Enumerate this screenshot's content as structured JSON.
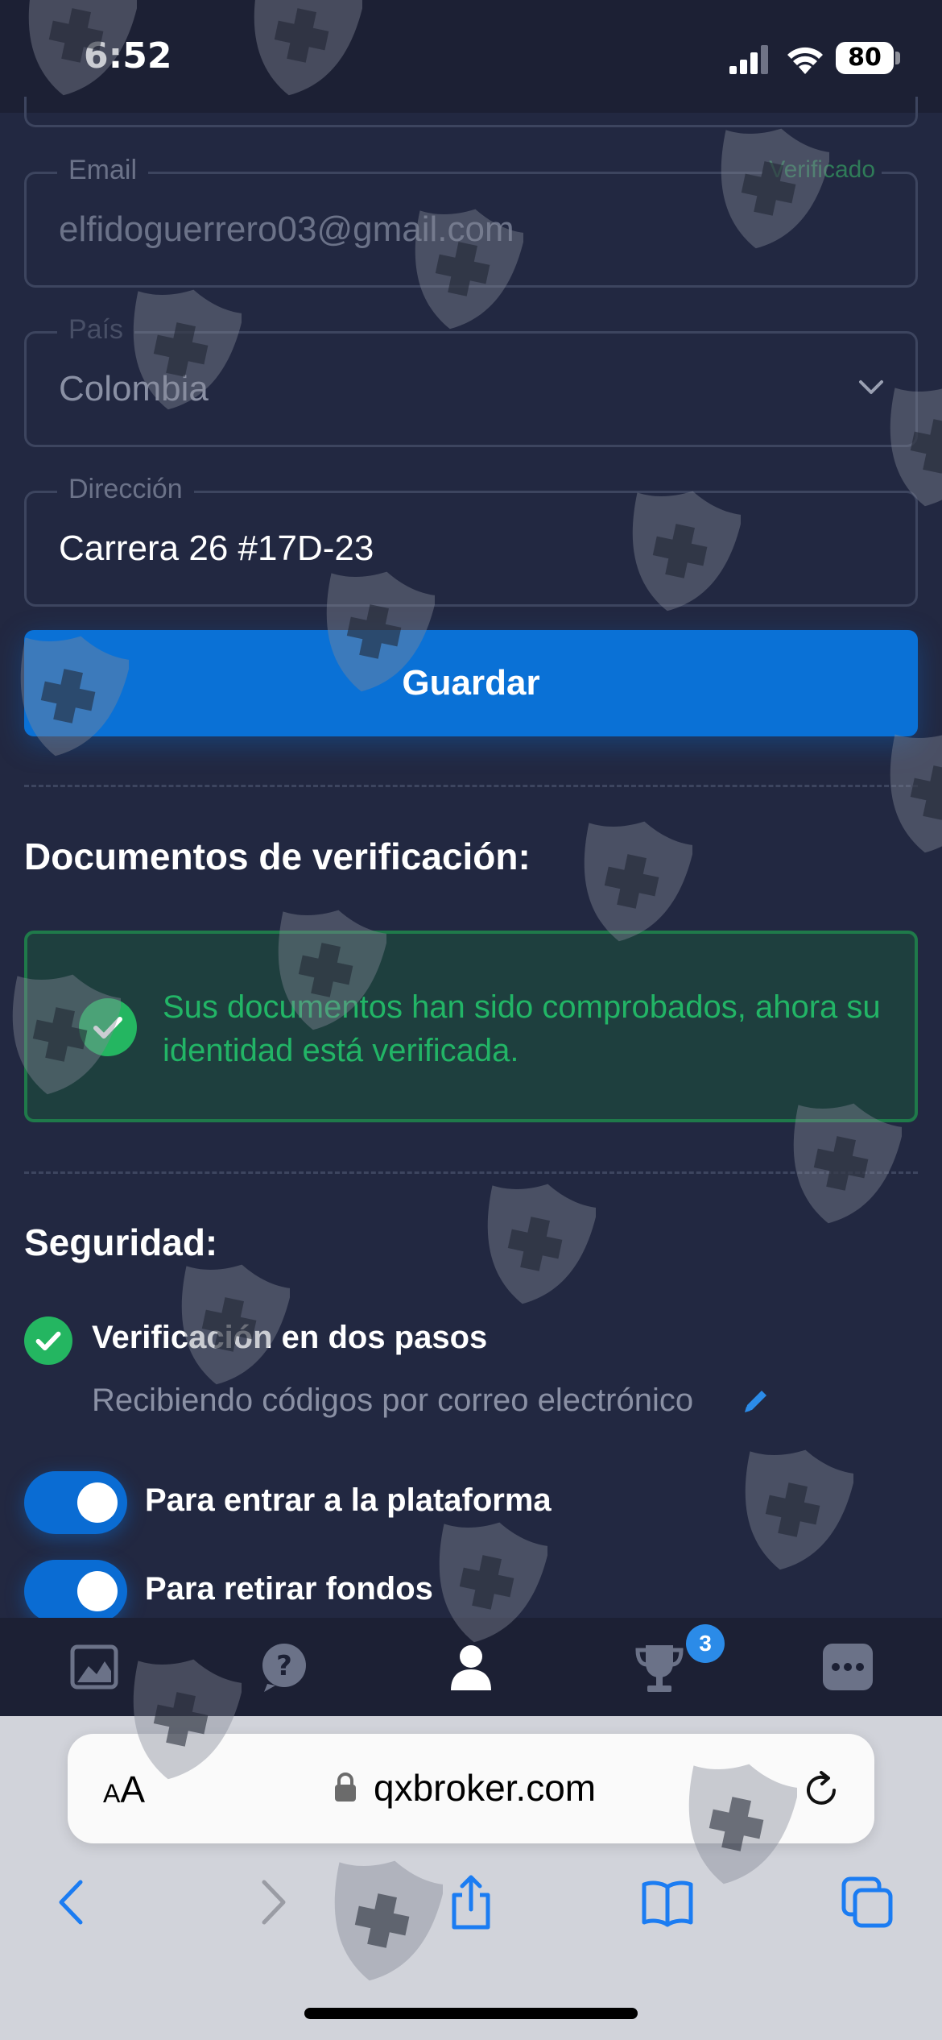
{
  "status_bar": {
    "time": "6:52",
    "battery": "80"
  },
  "form": {
    "email": {
      "label": "Email",
      "value": "elfidoguerrero03@gmail.com",
      "status": "Verificado"
    },
    "country": {
      "label": "País",
      "value": "Colombia"
    },
    "address": {
      "label": "Dirección",
      "value": "Carrera 26 #17D-23"
    },
    "save_label": "Guardar"
  },
  "verification": {
    "title": "Documentos de verificación:",
    "message": "Sus documentos han sido comprobados, ahora su identidad está verificada."
  },
  "security": {
    "title": "Seguridad:",
    "two_factor": {
      "title": "Verificación en dos pasos",
      "subtitle": "Recibiendo códigos por correo electrónico"
    },
    "toggles": [
      {
        "label": "Para entrar a la plataforma",
        "on": true
      },
      {
        "label": "Para retirar fondos",
        "on": true
      }
    ]
  },
  "tab_bar": {
    "items": [
      "chart-icon",
      "help-icon",
      "profile-icon",
      "trophy-icon",
      "more-icon"
    ],
    "active": "profile-icon",
    "trophy_badge": "3"
  },
  "browser": {
    "text_size_small": "A",
    "text_size_large": "A",
    "url": "qxbroker.com"
  },
  "colors": {
    "background": "#222841",
    "accent": "#0a71d6",
    "success": "#22b566"
  }
}
